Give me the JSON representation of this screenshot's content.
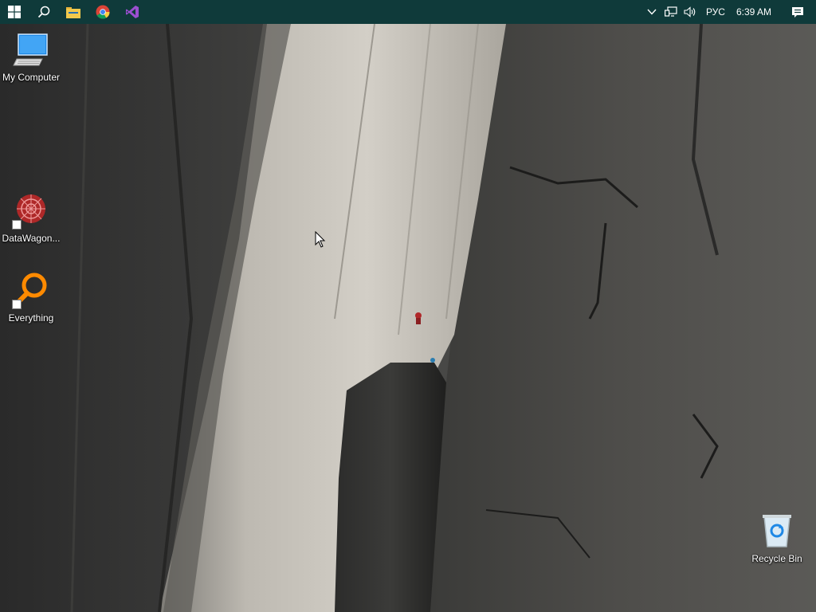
{
  "taskbar": {
    "background": "#0f3a3a",
    "pinned": [
      {
        "icon": "windows-start-icon"
      },
      {
        "icon": "search-icon"
      },
      {
        "icon": "file-explorer-icon"
      },
      {
        "icon": "chrome-icon"
      },
      {
        "icon": "visual-studio-icon"
      }
    ],
    "tray": {
      "language": "РУС",
      "time": "6:39 AM"
    }
  },
  "desktop": {
    "icons": [
      {
        "label": "My Computer",
        "icon": "monitor-icon"
      },
      {
        "label": "DataWagon...",
        "icon": "datawagon-icon",
        "shortcut": true
      },
      {
        "label": "Everything",
        "icon": "everything-search-icon",
        "shortcut": true
      },
      {
        "label": "Recycle Bin",
        "icon": "recycle-bin-icon"
      }
    ]
  }
}
